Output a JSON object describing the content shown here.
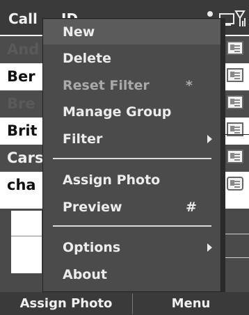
{
  "titlebar": {
    "title": "Call",
    "title_partial": "ID"
  },
  "contacts": [
    {
      "name": "And",
      "style": "dark"
    },
    {
      "name": "Ber",
      "style": "light"
    },
    {
      "name": "Bre",
      "style": "dark"
    },
    {
      "name": "Brit",
      "style": "light"
    },
    {
      "name": "Cars",
      "style": "dark"
    },
    {
      "name": "cha",
      "style": "light"
    }
  ],
  "menu": {
    "items": [
      {
        "label": "New",
        "shortcut": "",
        "selected": true
      },
      {
        "label": "Delete",
        "shortcut": ""
      },
      {
        "label": "Reset Filter",
        "shortcut": "*",
        "disabled": true
      },
      {
        "label": "Manage Group",
        "shortcut": ""
      },
      {
        "label": "Filter",
        "shortcut": "",
        "submenu": true
      },
      {
        "label": "Assign Photo",
        "shortcut": ""
      },
      {
        "label": "Preview",
        "shortcut": "#"
      },
      {
        "label": "Options",
        "shortcut": "",
        "submenu": true
      },
      {
        "label": "About",
        "shortcut": ""
      }
    ]
  },
  "softkeys": {
    "left": "Assign Photo",
    "right": "Menu"
  },
  "icons": {
    "status": [
      "person-icon",
      "signal-icon",
      "battery-icon"
    ],
    "contact_card": "contact-card-icon",
    "submenu": "chevron-right-icon"
  }
}
